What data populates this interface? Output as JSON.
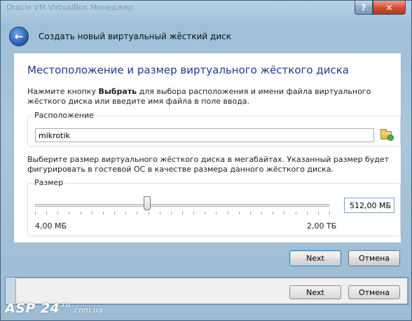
{
  "window": {
    "help_symbol": "?",
    "close_symbol": "✕",
    "ghost_title": "Oracle VM VirtualBox Менеджер"
  },
  "header": {
    "back_icon": "arrow-left-icon",
    "title": "Создать новый виртуальный жёсткий диск"
  },
  "page": {
    "heading": "Местоположение и размер виртуального жёсткого диска",
    "desc1_part1": "Нажмите кнопку ",
    "desc1_bold": "Выбрать",
    "desc1_part2": " для выбора расположения и имени файла виртуального жёсткого диска или введите имя файла в поле ввода.",
    "location": {
      "legend": "Расположение",
      "value": "mikrotik",
      "folder_icon": "folder-open-icon"
    },
    "desc2": "Выберите размер виртуального жёсткого диска в мегабайтах. Указанный размер будет фигурировать в гостевой ОС в качестве размера данного жёсткого диска.",
    "size": {
      "legend": "Размер",
      "value": "512,00 МБ",
      "min_label": "4,00 МБ",
      "max_label": "2,00 ТБ",
      "slider_fraction": 0.38
    }
  },
  "buttons": {
    "next": "Next",
    "cancel": "Отмена"
  },
  "parent_window": {
    "next": "Next",
    "cancel": "Отмена"
  },
  "watermark": {
    "main": "ASP 24",
    "sub": ".ru",
    "domain": ".com.ua"
  }
}
